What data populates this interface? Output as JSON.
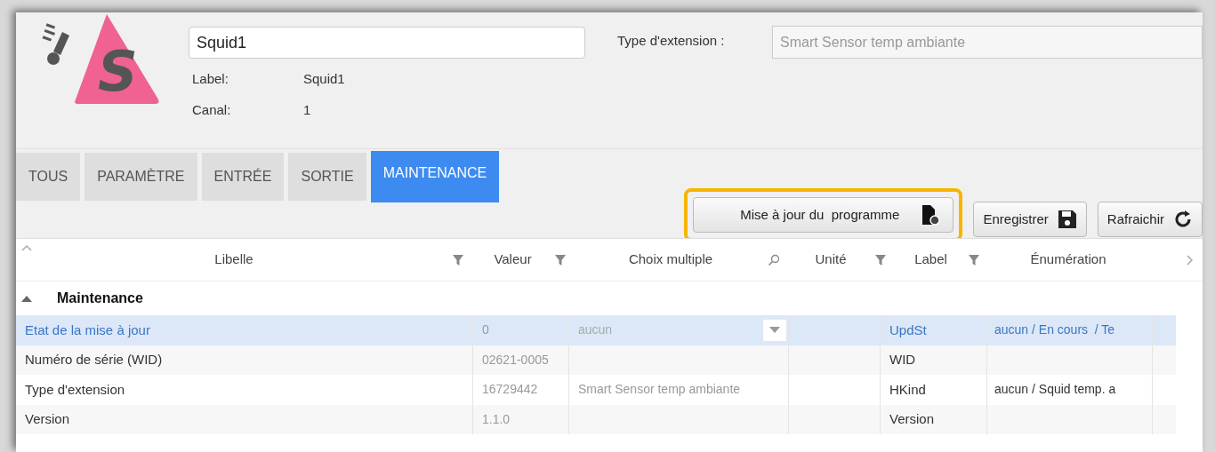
{
  "header": {
    "logo_letter": "S",
    "name_field": {
      "value": "Squid1"
    },
    "info": [
      {
        "label": "Label:",
        "value": "Squid1"
      },
      {
        "label": "Canal:",
        "value": "1"
      }
    ],
    "extension_type": {
      "label": "Type d'extension :",
      "value": "Smart Sensor temp ambiante",
      "disabled": true
    }
  },
  "tabs": [
    {
      "label": "TOUS",
      "selected": false
    },
    {
      "label": "PARAMÈTRE",
      "selected": false
    },
    {
      "label": "ENTRÉE",
      "selected": false
    },
    {
      "label": "SORTIE",
      "selected": false
    },
    {
      "label": "MAINTENANCE",
      "selected": true
    }
  ],
  "buttons": [
    {
      "label": "Mise à jour du  programme",
      "kind": "update",
      "highlighted": true
    },
    {
      "label": "Enregistrer",
      "kind": "save",
      "highlighted": false
    },
    {
      "label": "Rafraichir",
      "kind": "refresh",
      "highlighted": false
    }
  ],
  "table": {
    "columns": [
      {
        "label": "Libelle",
        "kind": "filter"
      },
      {
        "label": "Valeur",
        "kind": "filter"
      },
      {
        "label": "Choix multiple",
        "kind": "search"
      },
      {
        "label": "Unité",
        "kind": "filter"
      },
      {
        "label": "Label",
        "kind": "filter"
      },
      {
        "label": "Énumération",
        "kind": "plain"
      }
    ],
    "group": {
      "label": "Maintenance",
      "expanded": true
    },
    "rows": [
      {
        "libelle": "Etat de la mise à jour",
        "valeur": "0",
        "choix": {
          "kind": "select",
          "value": "aucun"
        },
        "label": "UpdSt",
        "enumeration": "aucun / En cours  / Te",
        "selected": true
      },
      {
        "libelle": "Numéro de série (WID)",
        "valeur": "02621-0005",
        "label": "WID",
        "selected": false
      },
      {
        "libelle": "Type d'extension",
        "valeur": "16729442",
        "choix": {
          "kind": "text",
          "value": "Smart Sensor temp ambiante"
        },
        "label": "HKind",
        "enumeration": "aucun / Squid temp. a",
        "selected": false
      },
      {
        "libelle": "Version",
        "valeur": "1.1.0",
        "label": "Version",
        "selected": false
      }
    ]
  }
}
